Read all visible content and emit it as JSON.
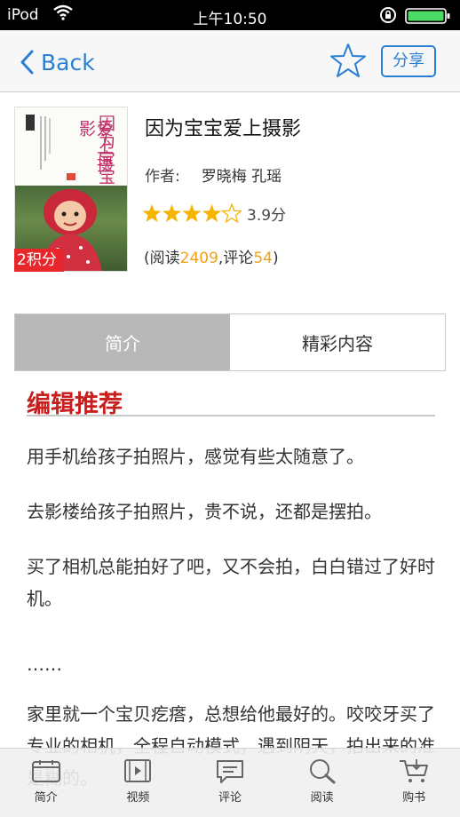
{
  "status_bar": {
    "carrier": "iPod",
    "time": "上午10:50"
  },
  "navbar": {
    "back_label": "Back",
    "share_label": "分享"
  },
  "book": {
    "cover_title_col1": "因为宝宝",
    "cover_title_col2": "爱上摄影",
    "points": "2积分",
    "title": "因为宝宝爱上摄影",
    "author_label": "作者:",
    "authors": "罗晓梅 孔瑶",
    "rating_stars": 4,
    "rating_max": 5,
    "rating_score": "3.9分",
    "stats": {
      "open": "(阅读",
      "reads": "2409",
      "comment_label": ",评论",
      "comments": "54",
      "close": ")"
    }
  },
  "tabs": [
    {
      "label": "简介",
      "active": true
    },
    {
      "label": "精彩内容",
      "active": false
    }
  ],
  "content": {
    "section_title": "编辑推荐",
    "paragraphs": [
      "用手机给孩子拍照片，感觉有些太随意了。",
      "去影楼给孩子拍照片，贵不说，还都是摆拍。",
      "买了相机总能拍好了吧，又不会拍，白白错过了好时机。",
      "……",
      "家里就一个宝贝疙瘩，总想给他最好的。咬咬牙买了专业的相机，全程自动模式，遇到阴天，拍出来的准是糊的。"
    ]
  },
  "tabbar": [
    {
      "label": "简介",
      "icon": "intro-icon"
    },
    {
      "label": "视频",
      "icon": "video-icon"
    },
    {
      "label": "评论",
      "icon": "comment-icon"
    },
    {
      "label": "阅读",
      "icon": "search-icon"
    },
    {
      "label": "购书",
      "icon": "cart-icon"
    }
  ],
  "colors": {
    "accent_blue": "#2a7fd4",
    "star_gold": "#f5b400",
    "section_red": "#c81e1e",
    "stat_orange": "#f0a21a"
  }
}
